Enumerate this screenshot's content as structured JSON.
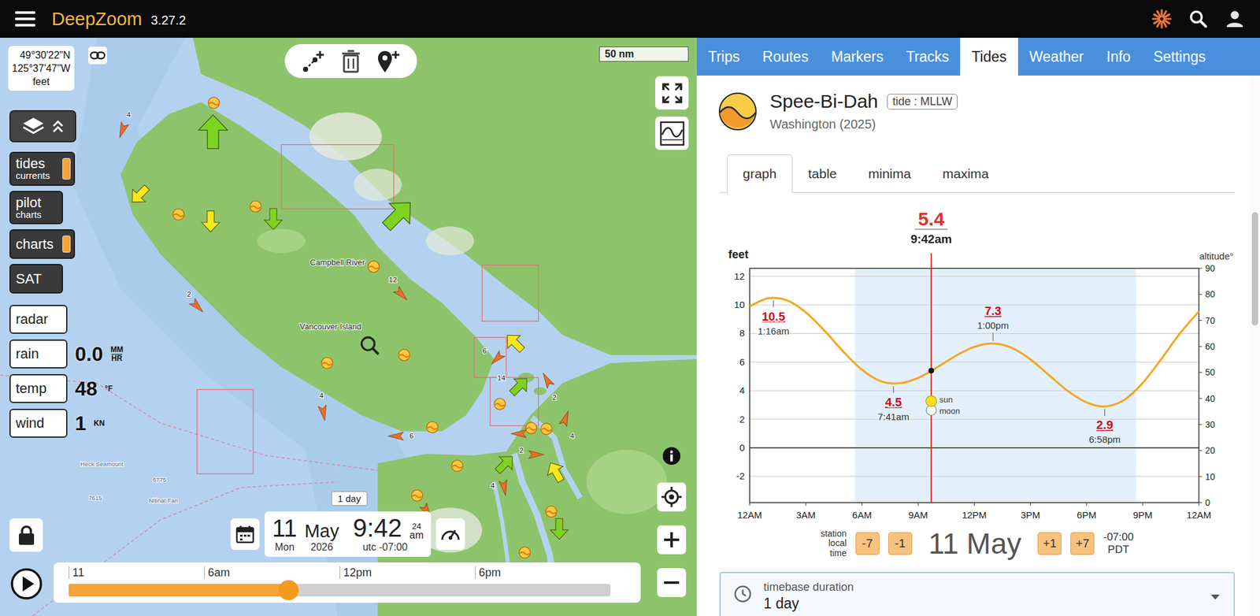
{
  "app": {
    "name": "DeepZoom",
    "version": "3.27.2"
  },
  "map": {
    "coordinates": {
      "lat": "49°30'22\"N",
      "lon": "125°37'47\"W",
      "units": "feet"
    },
    "scale": "50 nm",
    "layers": [
      {
        "label": "tides",
        "sub": "currents",
        "on": true
      },
      {
        "label": "pilot",
        "sub": "charts",
        "on": false
      },
      {
        "label": "charts",
        "sub": "",
        "on": true
      },
      {
        "label": "SAT",
        "sub": "",
        "on": false
      }
    ],
    "weather": [
      {
        "label": "radar",
        "value": "",
        "unit": []
      },
      {
        "label": "rain",
        "value": "0.0",
        "unit": [
          "MM",
          "HR"
        ]
      },
      {
        "label": "temp",
        "value": "48",
        "unit": [
          "°F"
        ]
      },
      {
        "label": "wind",
        "value": "1",
        "unit": [
          "KN"
        ]
      }
    ],
    "labels": [
      {
        "text": "Campbell River",
        "kind": "town"
      },
      {
        "text": "Vancouver Island",
        "kind": "region"
      },
      {
        "text": "Heck Seamount",
        "kind": "feature"
      },
      {
        "text": "Nitinat Fan",
        "kind": "feature"
      },
      {
        "text": "7615",
        "kind": "depth"
      },
      {
        "text": "6775",
        "kind": "depth"
      }
    ],
    "currents": [
      {
        "label": "",
        "heading": 0,
        "kind": "large",
        "color": "#7ed321"
      },
      {
        "label": "4",
        "heading": 200,
        "kind": "small",
        "color": "#e8702a"
      },
      {
        "label": "",
        "heading": 225,
        "kind": "medium",
        "color": "#f8e71c"
      },
      {
        "label": "",
        "heading": 180,
        "kind": "medium",
        "color": "#f8e71c"
      },
      {
        "label": "",
        "heading": 180,
        "kind": "medium",
        "color": "#7ed321"
      },
      {
        "label": "",
        "heading": 45,
        "kind": "large",
        "color": "#7ed321"
      },
      {
        "label": "12",
        "heading": 135,
        "kind": "small",
        "color": "#e8702a"
      },
      {
        "label": "2",
        "heading": 135,
        "kind": "small",
        "color": "#e8702a"
      },
      {
        "label": "4",
        "heading": 170,
        "kind": "small",
        "color": "#e8702a"
      },
      {
        "label": "6",
        "heading": 270,
        "kind": "small",
        "color": "#e8702a"
      },
      {
        "label": "",
        "heading": 315,
        "kind": "medium",
        "color": "#f8e71c"
      },
      {
        "label": "6",
        "heading": 225,
        "kind": "small",
        "color": "#e8702a"
      },
      {
        "label": "14",
        "heading": 45,
        "kind": "medium",
        "color": "#7ed321"
      },
      {
        "label": "2",
        "heading": 330,
        "kind": "small",
        "color": "#e8702a"
      },
      {
        "label": "4",
        "heading": 20,
        "kind": "small",
        "color": "#e8702a"
      },
      {
        "label": "",
        "heading": 270,
        "kind": "small",
        "color": "#e8702a"
      },
      {
        "label": "2",
        "heading": 90,
        "kind": "small",
        "color": "#e8702a"
      },
      {
        "label": "",
        "heading": 45,
        "kind": "medium",
        "color": "#7ed321"
      },
      {
        "label": "4",
        "heading": 170,
        "kind": "small",
        "color": "#e8702a"
      },
      {
        "label": "",
        "heading": 330,
        "kind": "medium",
        "color": "#f8e71c"
      },
      {
        "label": "",
        "heading": 180,
        "kind": "medium",
        "color": "#7ed321"
      },
      {
        "label": "",
        "heading": 150,
        "kind": "small",
        "color": "#e8702a"
      }
    ],
    "tide_stations": [
      {
        "kind": "tide"
      },
      {
        "kind": "tide"
      },
      {
        "kind": "tide"
      },
      {
        "kind": "tide"
      },
      {
        "kind": "tide"
      },
      {
        "kind": "tide"
      },
      {
        "kind": "tide"
      },
      {
        "kind": "tide"
      },
      {
        "kind": "tide"
      },
      {
        "kind": "tide"
      },
      {
        "kind": "tide"
      },
      {
        "kind": "tide"
      },
      {
        "kind": "tide"
      },
      {
        "kind": "tide"
      }
    ],
    "timeline": {
      "duration": "1 day",
      "day": "11",
      "month": "May",
      "time": "9:42",
      "clock": "24",
      "meridiem": "am",
      "weekday": "Mon",
      "year": "2026",
      "offset": "utc -07:00",
      "ticks": [
        "11",
        "6am",
        "12pm",
        "6pm"
      ],
      "level": 0.406
    }
  },
  "panel": {
    "tabs": [
      {
        "label": "Trips",
        "selected": false
      },
      {
        "label": "Routes",
        "selected": false
      },
      {
        "label": "Markers",
        "selected": false
      },
      {
        "label": "Tracks",
        "selected": false
      },
      {
        "label": "Tides",
        "selected": true
      },
      {
        "label": "Weather",
        "selected": false
      },
      {
        "label": "Info",
        "selected": false
      },
      {
        "label": "Settings",
        "selected": false
      }
    ],
    "station": {
      "name": "Spee-Bi-Dah",
      "datum": "tide : MLLW",
      "region": "Washington (2025)"
    },
    "views": [
      {
        "label": "graph",
        "selected": true
      },
      {
        "label": "table",
        "selected": false
      },
      {
        "label": "minima",
        "selected": false
      },
      {
        "label": "maxima",
        "selected": false
      }
    ],
    "chart": {
      "current": {
        "value": "5.4",
        "time": "9:42am",
        "hours": 9.7
      },
      "y_label": "feet",
      "y2_label": "altitude°",
      "y_ticks": [
        "12",
        "10",
        "8",
        "6",
        "4",
        "2",
        "0",
        "-2"
      ],
      "y2_ticks": [
        "90",
        "80",
        "70",
        "60",
        "50",
        "40",
        "30",
        "20",
        "10",
        "0"
      ],
      "x_ticks": [
        "12AM",
        "3AM",
        "6AM",
        "9AM",
        "12PM",
        "3PM",
        "6PM",
        "9PM",
        "12AM"
      ],
      "series": {
        "color": "#f5a623",
        "values": [
          9.9,
          10.47,
          10.31,
          9.48,
          8.19,
          6.74,
          5.46,
          4.66,
          4.52,
          4.9,
          5.62,
          6.43,
          7.06,
          7.3,
          7.0,
          6.19,
          5.08,
          3.98,
          3.18,
          2.9,
          3.35,
          4.55,
          6.23,
          8.03,
          9.55
        ]
      },
      "extremes": [
        {
          "value": "10.5",
          "time": "1:16am",
          "hours": 1.27,
          "feet": 10.5,
          "kind": "below"
        },
        {
          "value": "4.5",
          "time": "7:41am",
          "hours": 7.68,
          "feet": 4.5,
          "kind": "below"
        },
        {
          "value": "7.3",
          "time": "1:00pm",
          "hours": 13.0,
          "feet": 7.3,
          "kind": "above"
        },
        {
          "value": "2.9",
          "time": "6:58pm",
          "hours": 18.97,
          "feet": 2.9,
          "kind": "below"
        }
      ],
      "sun": {
        "label": "sun",
        "altitude": 39,
        "color": "#f8e21c"
      },
      "moon": {
        "label": "moon",
        "altitude": 35.5,
        "color": "#ffffff"
      },
      "daylight": {
        "start": 5.62,
        "end": 20.64
      }
    },
    "day_nav": {
      "caption": [
        "station",
        "local",
        "time"
      ],
      "back": [
        "-7",
        "-1"
      ],
      "date": "11 May",
      "forward": [
        "+1",
        "+7"
      ],
      "offset": "-07:00",
      "zone": "PDT"
    },
    "timebase": {
      "label": "timebase duration",
      "value": "1 day"
    },
    "scrollbar": {
      "level": 0.32
    }
  }
}
